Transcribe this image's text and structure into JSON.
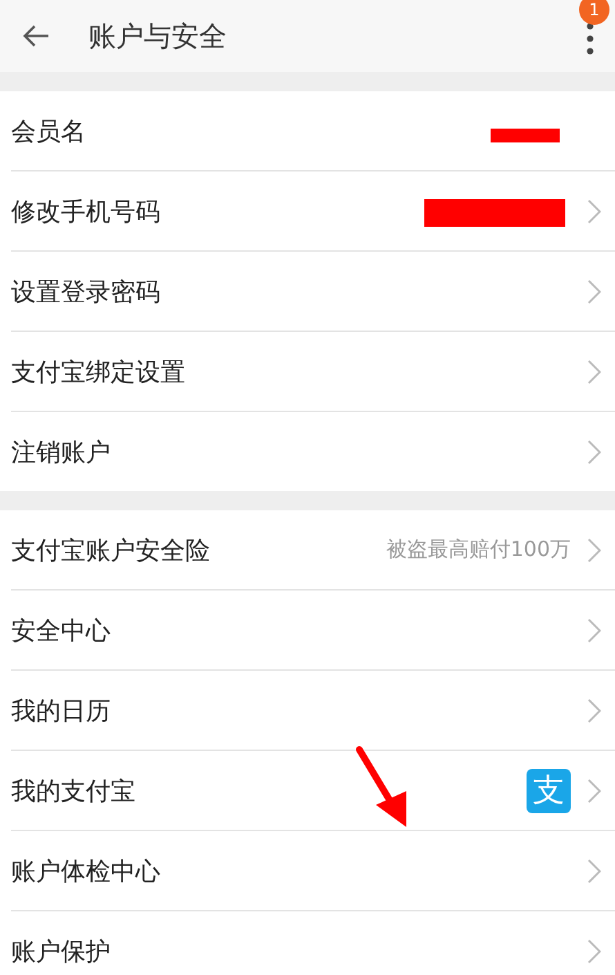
{
  "header": {
    "title": "账户与安全",
    "badge": "1"
  },
  "groups": [
    {
      "rows": [
        {
          "label": "会员名",
          "redacted": true,
          "chevron": false
        },
        {
          "label": "修改手机号码",
          "redacted": true,
          "chevron": true
        },
        {
          "label": "设置登录密码",
          "redacted": false,
          "chevron": true
        },
        {
          "label": "支付宝绑定设置",
          "redacted": false,
          "chevron": true
        },
        {
          "label": "注销账户",
          "redacted": false,
          "chevron": true
        }
      ]
    },
    {
      "rows": [
        {
          "label": "支付宝账户安全险",
          "value": "被盗最高赔付100万",
          "redacted": false,
          "chevron": true
        },
        {
          "label": "安全中心",
          "redacted": false,
          "chevron": true
        },
        {
          "label": "我的日历",
          "redacted": false,
          "chevron": true
        },
        {
          "label": "我的支付宝",
          "logo": "支",
          "redacted": false,
          "chevron": true
        },
        {
          "label": "账户体检中心",
          "redacted": false,
          "chevron": true
        },
        {
          "label": "账户保护",
          "redacted": false,
          "chevron": true
        }
      ]
    }
  ],
  "annotation": {
    "kind": "arrow"
  }
}
